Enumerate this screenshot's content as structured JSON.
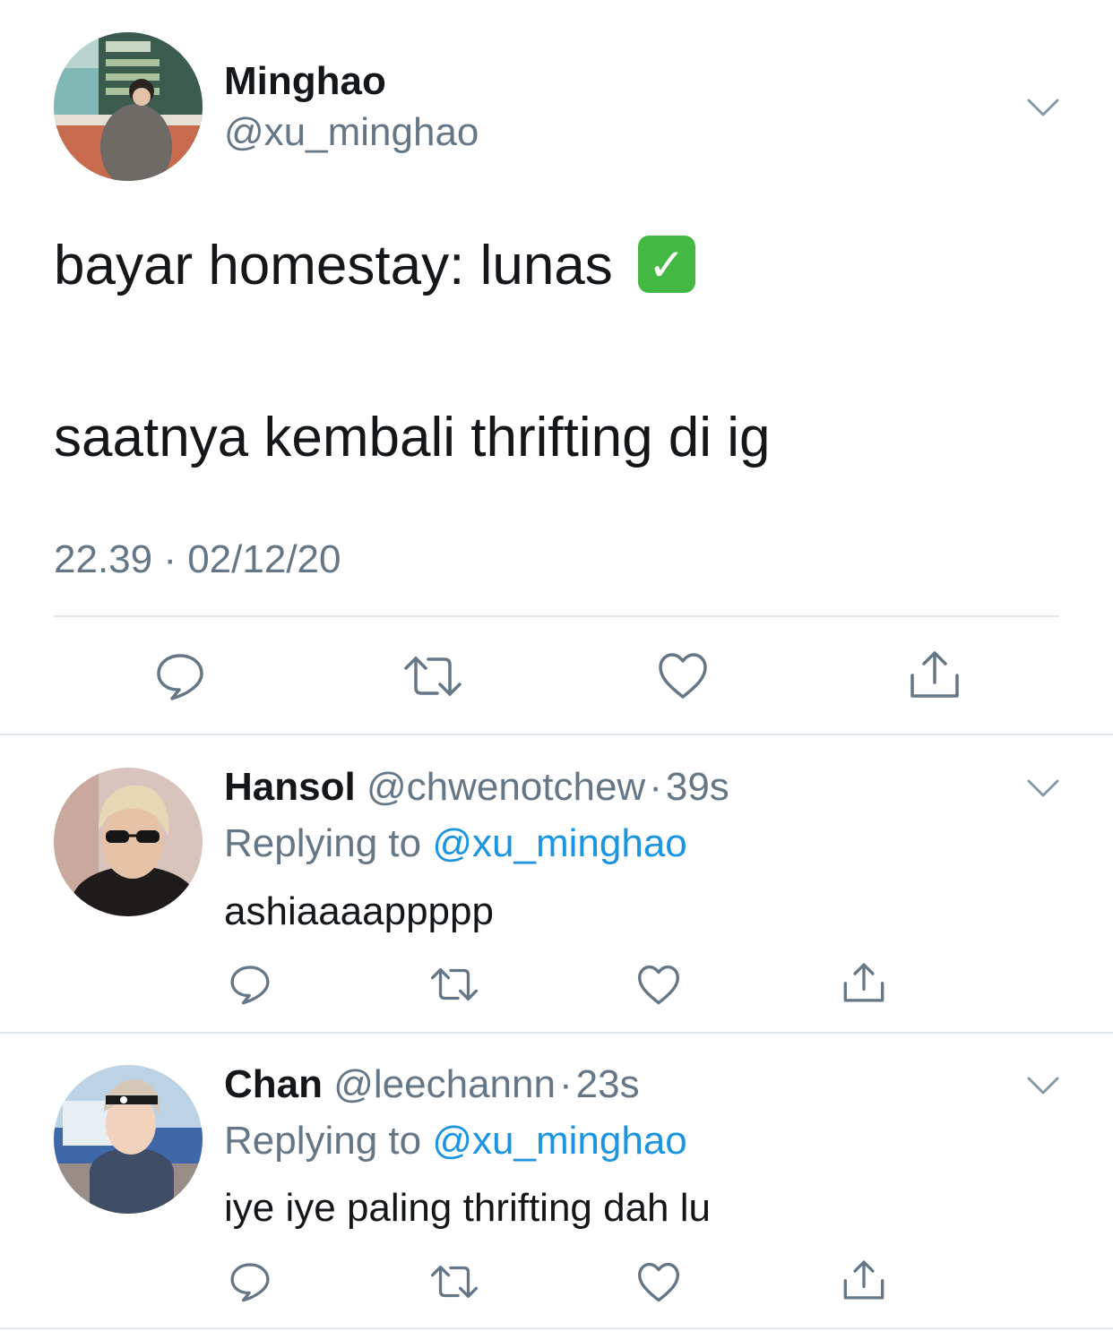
{
  "main_tweet": {
    "display_name": "Minghao",
    "handle": "@xu_minghao",
    "avatar_icon": "profile-photo",
    "text_line1": "bayar homestay: lunas",
    "check_emoji": "✓",
    "text_line2": "saatnya kembali thrifting di ig",
    "timestamp": "22.39 · 02/12/20",
    "actions": [
      "reply-icon",
      "retweet-icon",
      "like-icon",
      "share-icon"
    ]
  },
  "replies": [
    {
      "display_name": "Hansol",
      "handle": "@chwenotchew",
      "separator": "·",
      "time": "39s",
      "replying_prefix": "Replying to",
      "replying_handle": "@xu_minghao",
      "text": "ashiaaaappppp",
      "avatar_icon": "profile-photo"
    },
    {
      "display_name": "Chan",
      "handle": "@leechannn",
      "separator": "·",
      "time": "23s",
      "replying_prefix": "Replying to",
      "replying_handle": "@xu_minghao",
      "text": "iye iye paling thrifting dah lu",
      "avatar_icon": "profile-photo"
    }
  ],
  "colors": {
    "text": "#14171a",
    "secondary": "#657786",
    "link": "#1b95e0",
    "divider": "#e1e8ed",
    "check": "#43b943"
  }
}
